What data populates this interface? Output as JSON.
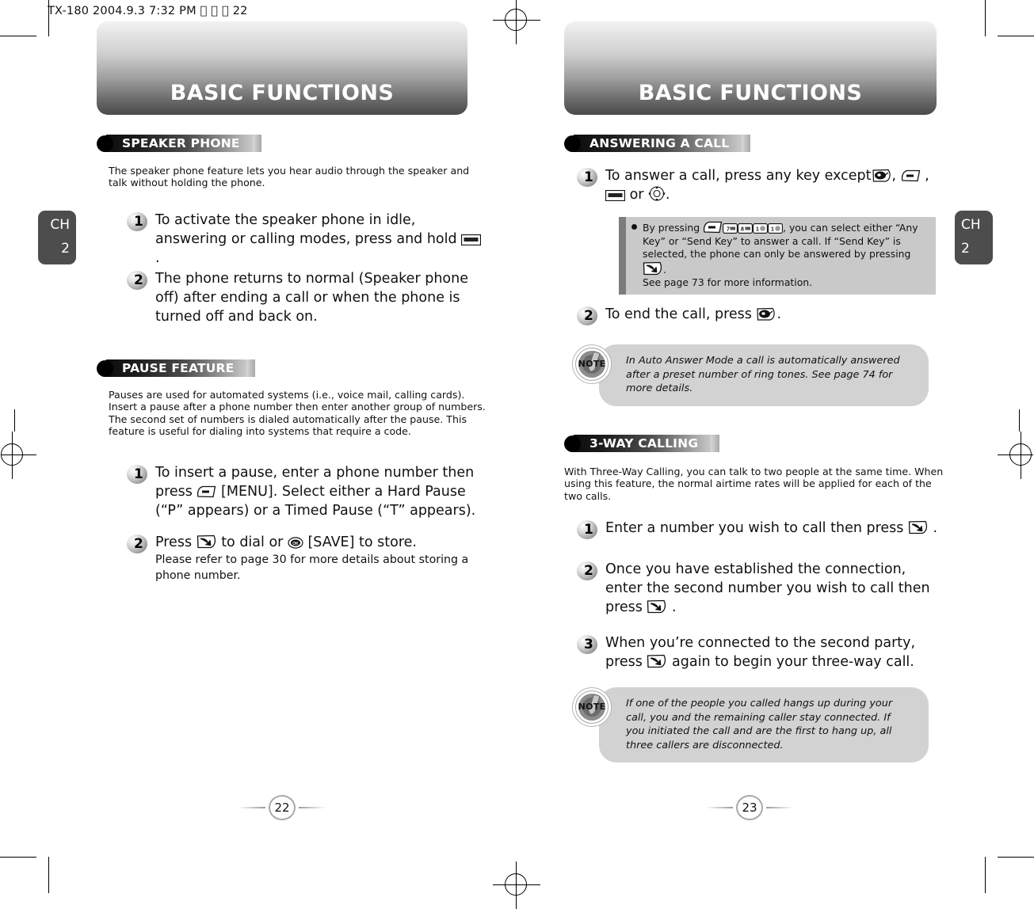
{
  "meta_line": "TX-180  2004.9.3 7:32 PM     22",
  "left_page": {
    "banner_title": "BASIC FUNCTIONS",
    "chapter_tab": {
      "label": "CH",
      "number": "2"
    },
    "page_number": "22",
    "sections": [
      {
        "title": "SPEAKER PHONE",
        "intro": "The speaker phone feature lets you hear audio through the speaker and talk without holding the phone.",
        "steps": [
          {
            "num": "1",
            "text_before": "To activate the speaker phone in idle, answering or calling modes, press and hold ",
            "icon": "speaker-key-icon",
            "text_after": " ."
          },
          {
            "num": "2",
            "text_before": "The phone returns to normal (Speaker phone off) after ending a call or when the phone is turned off and back on.",
            "icon": "",
            "text_after": ""
          }
        ]
      },
      {
        "title": "PAUSE FEATURE",
        "intro": "Pauses are used for automated systems (i.e., voice mail, calling cards). Insert a pause after a phone number then enter another group of numbers. The second set of numbers is dialed automatically after the pause. This feature is useful for dialing into systems that require a code.",
        "steps": [
          {
            "num": "1",
            "part1": "To insert a pause, enter a phone number then press ",
            "icon1": "menu-key-icon",
            "part2": " [MENU]. Select either a Hard Pause (“P” appears) or a Timed Pause (“T” appears)."
          },
          {
            "num": "2",
            "part1": "Press ",
            "icon1": "send-key-icon",
            "part2": " to dial or ",
            "icon2": "ok-key-icon",
            "part3": " [SAVE] to store.",
            "sub": "Please refer to page 30 for more details about storing a phone number."
          }
        ]
      }
    ]
  },
  "right_page": {
    "banner_title": "BASIC FUNCTIONS",
    "chapter_tab": {
      "label": "CH",
      "number": "2"
    },
    "page_number": "23",
    "sections": [
      {
        "title": "ANSWERING A CALL",
        "steps": [
          {
            "num": "1",
            "p1": "To answer a call, press any key except",
            "i1": "end-key-icon",
            "p2": ", ",
            "i2": "menu-key-icon",
            "p3": " ,",
            "i3": "speaker-key-icon",
            "p4": " or ",
            "i4": "navigation-key-icon",
            "p5": "."
          },
          {
            "num": "2",
            "p1": "To end the call, press ",
            "i1": "end-key-icon",
            "p2": "."
          }
        ],
        "grey_note": {
          "p1": "By pressing ",
          "keys": [
            "menu-key-icon",
            "num-7-key-icon",
            "num-8-key-icon",
            "num-1-key-icon",
            "num-1-key-icon"
          ],
          "p2": ", you can select either “Any Key” or “Send Key” to answer a call. If “Send Key” is selected, the phone can only be answered by pressing",
          "i2": "send-key-icon",
          "p3": ".",
          "p4": "See page 73 for more information."
        },
        "note": "In Auto Answer Mode a call is automatically answered after a preset number of ring tones. See page 74 for more details.",
        "note_badge_label": "NOTE"
      },
      {
        "title": "3-WAY CALLING",
        "intro": "With Three-Way Calling, you can talk to two people at the same time. When using this feature, the normal airtime rates will be applied for each of the two calls.",
        "steps": [
          {
            "num": "1",
            "p1": "Enter a number you wish to call then press ",
            "i1": "send-key-icon",
            "p2": " ."
          },
          {
            "num": "2",
            "p1": "Once you have established the connection, enter the second number you wish to call then press ",
            "i1": "send-key-icon",
            "p2": " ."
          },
          {
            "num": "3",
            "p1": "When you’re connected to the second party, press ",
            "i1": "send-key-icon",
            "p2": " again to begin your three-way call."
          }
        ],
        "note": "If one of the people you called hangs up during your call, you and the remaining caller stay connected. If you initiated the call and are the first to hang up, all three callers are disconnected.",
        "note_badge_label": "NOTE"
      }
    ]
  },
  "colors": {
    "banner_dark": "#4a4a4a",
    "tab_gray": "#4d4d4d",
    "note_bg": "#d2d2d2",
    "grey_box": "#c9c9c9",
    "grey_box_bar": "#7c7c7c"
  }
}
